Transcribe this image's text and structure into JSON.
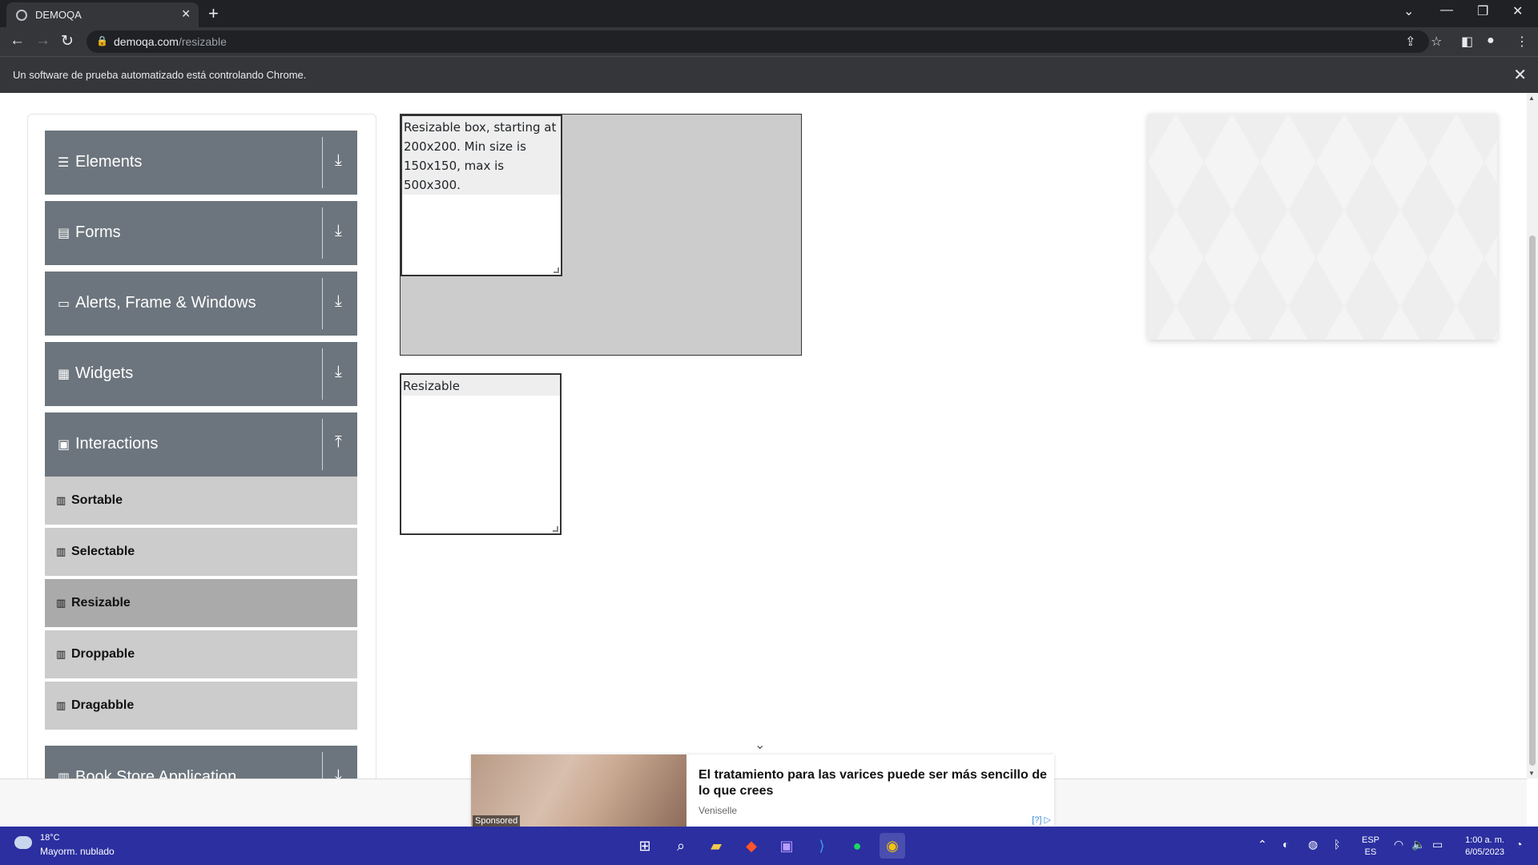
{
  "browser": {
    "tab_title": "DEMOQA",
    "url_domain": "demoqa.com",
    "url_path": "/resizable",
    "infobar_message": "Un software de prueba automatizado está controlando Chrome."
  },
  "sidebar": {
    "groups": [
      {
        "title": "Elements",
        "icon": "hamburger-icon",
        "arrow": "download-arrow-icon"
      },
      {
        "title": "Forms",
        "icon": "form-icon",
        "arrow": "download-arrow-icon"
      },
      {
        "title": "Alerts, Frame & Windows",
        "icon": "window-icon",
        "arrow": "download-arrow-icon"
      },
      {
        "title": "Widgets",
        "icon": "widgets-icon",
        "arrow": "download-arrow-icon"
      },
      {
        "title": "Interactions",
        "icon": "interactions-icon",
        "arrow": "upload-arrow-icon"
      },
      {
        "title": "Book Store Application",
        "icon": "book-icon",
        "arrow": "download-arrow-icon"
      }
    ],
    "interaction_items": [
      "Sortable",
      "Selectable",
      "Resizable",
      "Droppable",
      "Dragabble"
    ],
    "active_item": "Resizable"
  },
  "main": {
    "resizable_box_text": "Resizable box, starting at 200x200. Min size is 150x150, max is 500x300.",
    "resizable_text": "Resizable"
  },
  "bottom_ad": {
    "headline": "El tratamiento para las varices puede ser más sencillo de lo que crees",
    "advertiser": "Veniselle",
    "sponsored_label": "Sponsored",
    "choices_label": "[?]"
  },
  "taskbar": {
    "temperature": "18°C",
    "weather": "Mayorm. nublado",
    "lang_top": "ESP",
    "lang_bottom": "ES",
    "time": "1:00 a. m.",
    "date": "6/05/2023"
  },
  "colors": {
    "menu_header": "#6c757d",
    "menu_item": "#cccccc",
    "menu_item_active": "#aaaaaa",
    "taskbar": "#2b2fa0"
  }
}
